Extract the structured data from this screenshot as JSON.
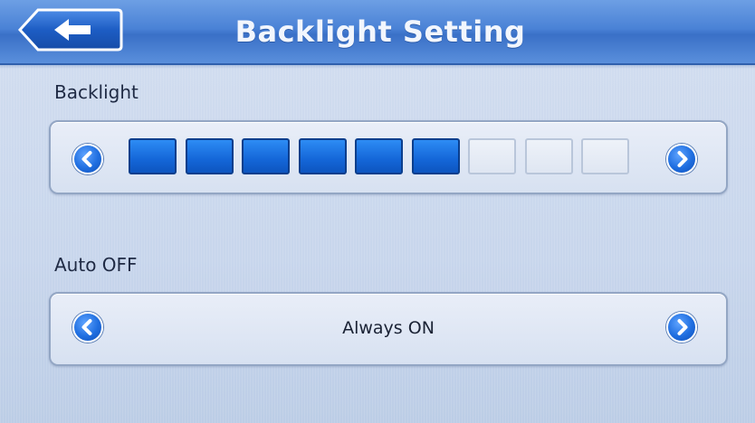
{
  "header": {
    "title": "Backlight Setting",
    "back_icon": "back-arrow-icon"
  },
  "backlight": {
    "label": "Backlight",
    "level": 6,
    "max_level": 9,
    "decrease_icon": "chevron-left-icon",
    "increase_icon": "chevron-right-icon"
  },
  "auto_off": {
    "label": "Auto OFF",
    "value": "Always ON",
    "prev_icon": "chevron-left-icon",
    "next_icon": "chevron-right-icon"
  },
  "colors": {
    "accent": "#1466d8",
    "title_bar": "#4a82d6",
    "background": "#c9d8ee"
  }
}
